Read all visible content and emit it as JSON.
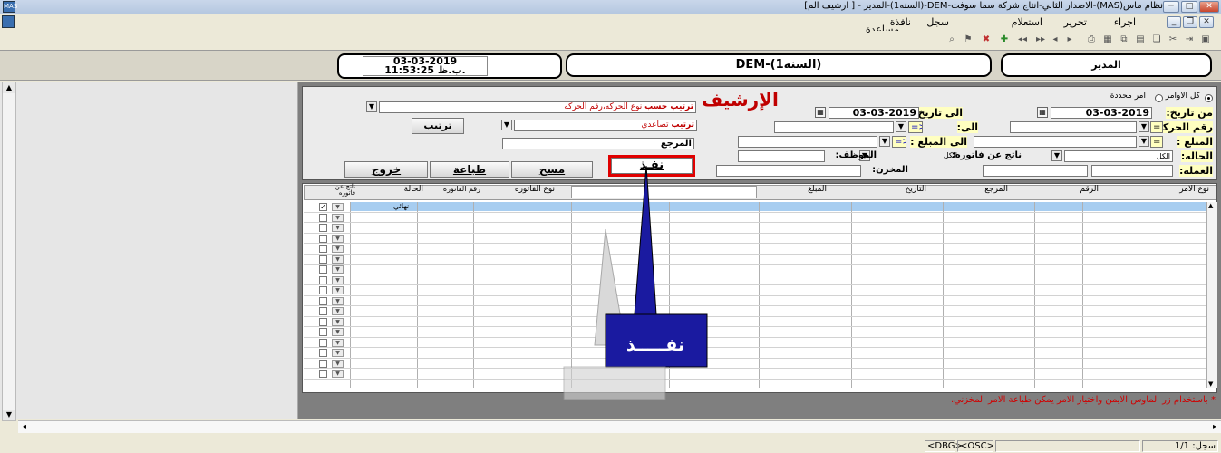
{
  "window": {
    "title": "نظام ماس(MAS)-الاصدار الثاني-انتاج شركة سما سوفت-DEM-(السنه1)-المدير - [ ارشيف الم]",
    "icon_label": "MAS"
  },
  "menu": {
    "items": [
      "اجراء",
      "تحرير",
      "استعلام",
      "سجل",
      "نافذة",
      "مساعدة"
    ]
  },
  "toolbar": {
    "icons": [
      "save-icon",
      "insert-icon",
      "cut-icon",
      "copy-icon",
      "paste-icon",
      "copy-record-icon",
      "report-icon",
      "print-icon",
      "first-record-icon",
      "prev-record-icon",
      "next-record-icon",
      "last-record-icon",
      "add-record-icon",
      "delete-record-icon",
      "filter-icon",
      "find-icon"
    ]
  },
  "header": {
    "user": "المدير",
    "company": "DEM-(السنه1)",
    "date": "03-03-2019",
    "time": "11:53:25 ب.ظ."
  },
  "form": {
    "title": "الإرشيف",
    "radio_all": "كل الاوامر",
    "radio_specific": "امر محددة",
    "from_date_label": "من تاريخ:",
    "from_date": "03-03-2019",
    "to_date_label": "الى تاريخ:",
    "to_date": "03-03-2019",
    "movement_no_label": "رقم الحركه:",
    "op_eq": "=",
    "to_label": "الى:",
    "op_gte": "=>",
    "amount_label": "المبلغ :",
    "to_amount_label": "الى المبلغ :",
    "status_label": "الحاله:",
    "status_value": "الكل",
    "invoice_result_label": "ناتج عن فاتوره:",
    "invoice_result_value": "الكل",
    "employee_label": "الموظف:",
    "currency_label": "العمله:",
    "store_label": "المخزن:",
    "sort_by_label": "ترتيب حسب",
    "sort_by_value": "نوع الحركه،رقم الحركه",
    "sort_order_label": "ترتيب",
    "sort_order_value": "تصاعدي",
    "sort_button": "ترتيب",
    "reference_label": "المرجع",
    "execute_button": "نفـذ",
    "clear_button": "مسح",
    "print_button": "طباعة",
    "exit_button": "خروج"
  },
  "grid": {
    "columns": [
      "نوع الامر",
      "الرقم",
      "المرجع",
      "التاريخ",
      "المبلغ",
      "نوع الفاتوره",
      "رقم الفاتوره",
      "الحالة",
      "ناتج عن فاتوره"
    ],
    "first_row_status": "نهائي"
  },
  "note": "* باستخدام زر الماوس الايمن واختيار الامر يمكن طباعة الامر المخزني.",
  "callout": {
    "text": "نفـــــذ"
  },
  "status": {
    "record": "سجل: 1/1",
    "dbg": "<DBG>",
    "osc": "<OSC>"
  },
  "colors": {
    "selected_row": "#a7cdf0",
    "callout_fill": "#1a1aa0",
    "highlight_border": "#e00000",
    "title_red": "#c00000"
  }
}
